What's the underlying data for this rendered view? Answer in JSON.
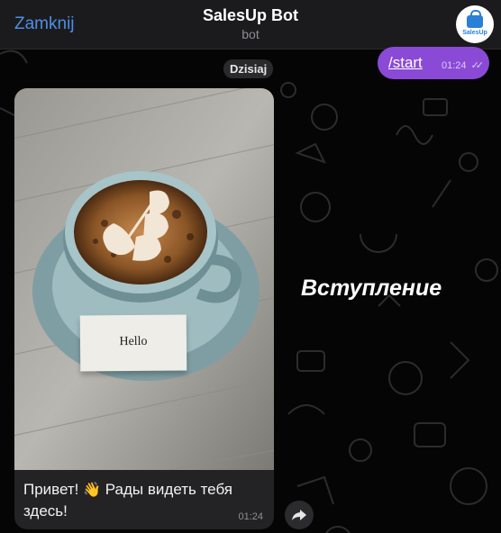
{
  "header": {
    "close_label": "Zamknij",
    "title": "SalesUp Bot",
    "subtitle": "bot",
    "avatar_text": "SalesUp"
  },
  "chat": {
    "date_label": "Dzisiaj",
    "outgoing": {
      "text": "/start",
      "time": "01:24",
      "status_icon": "double-check-icon"
    },
    "incoming": {
      "photo_card_text": "Hello",
      "caption_before": "Привет! ",
      "caption_emoji": "👋",
      "caption_after": " Рады видеть тебя здесь!",
      "time": "01:24"
    },
    "share_icon": "share-arrow-icon"
  },
  "overlay": {
    "label": "Вступление"
  },
  "colors": {
    "accent": "#4e8ee6",
    "outgoing_bubble": "#8a4ad6",
    "incoming_bubble": "#232325",
    "background": "#050505"
  }
}
